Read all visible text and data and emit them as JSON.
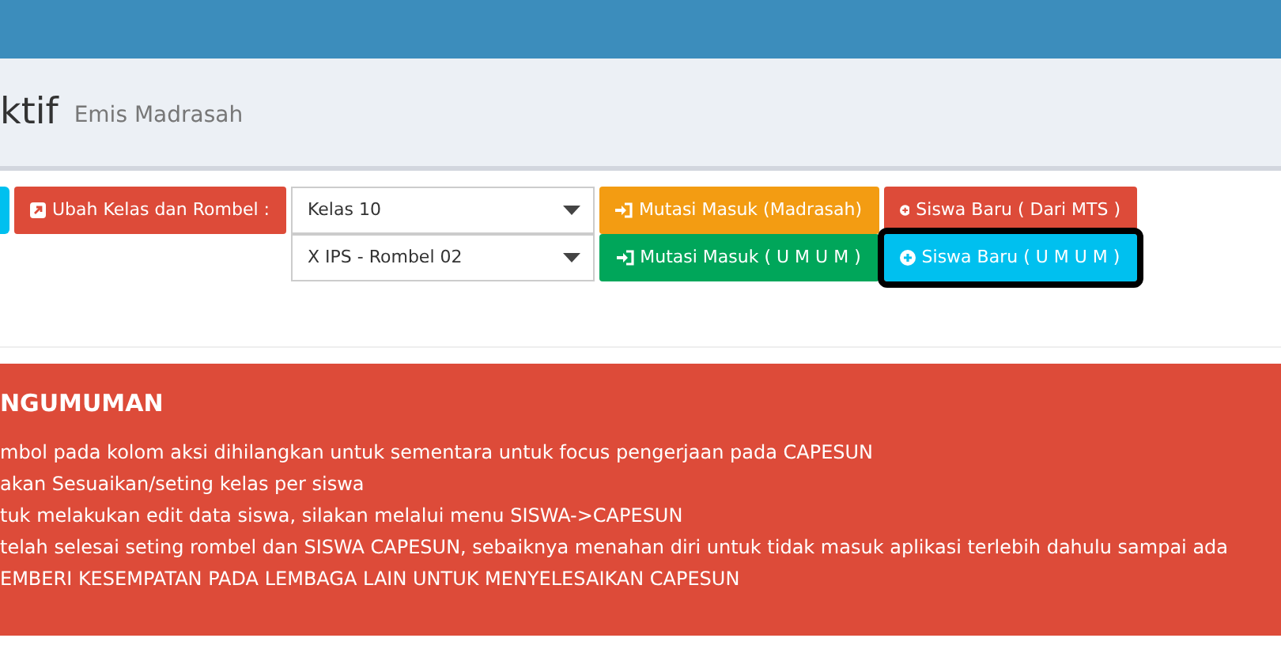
{
  "header": {
    "title": "ktif",
    "subtitle": "Emis Madrasah"
  },
  "toolbar": {
    "label_button": {
      "text": "Ubah Kelas dan Rombel :"
    },
    "selects": [
      {
        "value": "Kelas 10"
      },
      {
        "value": "X IPS - Rombel 02"
      }
    ],
    "buttons": [
      {
        "text": "Mutasi Masuk (Madrasah)",
        "kind": "signin",
        "color": "#f39c12",
        "focused": false
      },
      {
        "text": "Siswa Baru ( Dari MTS )",
        "kind": "plus",
        "color": "#dd4b39",
        "focused": false
      },
      {
        "text": "Mutasi Masuk ( U M U M )",
        "kind": "signin",
        "color": "#00a65a",
        "focused": false
      },
      {
        "text": "Siswa Baru ( U M U M )",
        "kind": "plus",
        "color": "#00c0ef",
        "focused": true
      }
    ]
  },
  "announcement": {
    "title": "NGUMUMAN",
    "lines": [
      "mbol pada kolom aksi dihilangkan untuk sementara untuk focus pengerjaan pada CAPESUN",
      "akan Sesuaikan/seting kelas per siswa",
      "tuk melakukan edit data siswa, silakan melalui menu SISWA->CAPESUN",
      "telah selesai seting rombel dan SISWA CAPESUN, sebaiknya menahan diri untuk tidak masuk aplikasi terlebih dahulu sampai ada",
      "EMBERI KESEMPATAN PADA LEMBAGA LAIN UNTUK MENYELESAIKAN CAPESUN"
    ]
  }
}
